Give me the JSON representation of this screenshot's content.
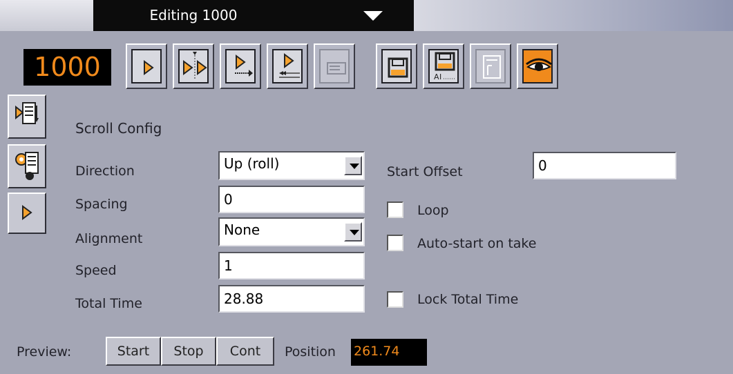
{
  "window": {
    "title": "Editing 1000"
  },
  "element_id": "1000",
  "toolbar": {
    "buttons": [
      {
        "name": "play-icon"
      },
      {
        "name": "continue-icon"
      },
      {
        "name": "take-out-icon"
      },
      {
        "name": "rewind-icon"
      },
      {
        "name": "preview-disabled-icon"
      },
      {
        "name": "save-icon"
      },
      {
        "name": "save-as-icon"
      },
      {
        "name": "page-disabled-icon"
      },
      {
        "name": "eye-icon"
      }
    ]
  },
  "sidebar": {
    "buttons": [
      {
        "name": "scroll-editor-icon"
      },
      {
        "name": "settings-icon"
      },
      {
        "name": "play-icon"
      }
    ]
  },
  "form": {
    "section_title": "Scroll Config",
    "direction": {
      "label": "Direction",
      "value": "Up (roll)"
    },
    "spacing": {
      "label": "Spacing",
      "value": "0"
    },
    "alignment": {
      "label": "Alignment",
      "value": "None"
    },
    "speed": {
      "label": "Speed",
      "value": "1"
    },
    "total_time": {
      "label": "Total Time",
      "value": "28.88"
    },
    "start_offset": {
      "label": "Start Offset",
      "value": "0"
    },
    "loop": {
      "label": "Loop",
      "checked": false
    },
    "auto_start": {
      "label": "Auto-start on take",
      "checked": false
    },
    "lock_total_time": {
      "label": "Lock Total Time",
      "checked": false
    }
  },
  "preview": {
    "label": "Preview:",
    "start": "Start",
    "stop": "Stop",
    "cont": "Cont",
    "position_label": "Position",
    "position_value": "261.74"
  },
  "colors": {
    "accent": "#f08a1c",
    "background": "#a4a6b5"
  }
}
